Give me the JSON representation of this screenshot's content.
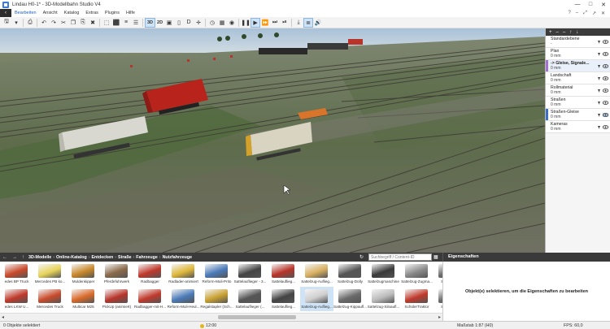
{
  "window": {
    "title": "Lindau H0-1* - 3D-Modellbahn Studio V4",
    "controls": [
      "—",
      "□",
      "✕"
    ]
  },
  "menu": {
    "back": "‹",
    "items": [
      "Bearbeiten",
      "Ansicht",
      "Katalog",
      "Extras",
      "Plugins",
      "Hilfe"
    ],
    "right": [
      "?",
      "–",
      "⤢",
      "↗",
      "✕"
    ]
  },
  "toolbar": {
    "view_3d": "3D",
    "view_2d": "2D"
  },
  "layers": {
    "toolbar": [
      "+",
      "–",
      "–",
      "↑",
      "↓"
    ],
    "items": [
      {
        "name": "Standardebene",
        "value": "-",
        "color": "#ffffff"
      },
      {
        "name": "Plan",
        "value": "0 mm",
        "color": "#ffffff"
      },
      {
        "name": "-> Gleise, Signale...",
        "value": "0 mm",
        "color": "#a36fd1"
      },
      {
        "name": "Landschaft",
        "value": "0 mm",
        "color": "#ffffff"
      },
      {
        "name": "Rollmaterial",
        "value": "0 mm",
        "color": "#ffffff"
      },
      {
        "name": "Straßen",
        "value": "0 mm",
        "color": "#ffffff"
      },
      {
        "name": "Straßen-Gleise",
        "value": "0 mm",
        "color": "#3b6fc4"
      },
      {
        "name": "Kameras",
        "value": "0 mm",
        "color": "#ffffff"
      }
    ]
  },
  "catalog": {
    "breadcrumb": [
      "3D-Modelle",
      "Online-Katalog",
      "Entdecken",
      "Straße",
      "Fahrzeuge",
      "Nutzfahrzeuge"
    ],
    "search_placeholder": "Suchbegriff / Content-ID",
    "row1": [
      {
        "label": "edes BP Truck",
        "color": "#c94a2a"
      },
      {
        "label": "Mercedes PB ko...",
        "color": "#e8d45a"
      },
      {
        "label": "Muldenkipper",
        "color": "#c9882a"
      },
      {
        "label": "Pferdefuhrwerk",
        "color": "#8a6a4a"
      },
      {
        "label": "Radbagger",
        "color": "#c0392b"
      },
      {
        "label": "Radlader-animiert",
        "color": "#e0b83a"
      },
      {
        "label": "Reform-Muli-Prito",
        "color": "#4a7ab8"
      },
      {
        "label": "Sattelauflieger - 3...",
        "color": "#444444"
      },
      {
        "label": "Sattelauflieg...",
        "color": "#b8342a"
      },
      {
        "label": "Sattelzug-Auflieg...",
        "color": "#d9b060"
      },
      {
        "label": "Sattelzug-Dolly",
        "color": "#555555"
      },
      {
        "label": "Sattelzugmaschine",
        "color": "#3a3a3a"
      },
      {
        "label": "Sattelzug-Zugma...",
        "color": "#8a8a8a"
      },
      {
        "label": "Schwerla...",
        "color": "#6a6a6a"
      }
    ],
    "row2": [
      {
        "label": "edes LKW U...",
        "color": "#c0392b"
      },
      {
        "label": "Mercedes Truck",
        "color": "#c94a2a"
      },
      {
        "label": "Multicar M25",
        "color": "#d96a2a"
      },
      {
        "label": "PickUp (animiert)",
        "color": "#b8342a"
      },
      {
        "label": "Radbagger-mit-H...",
        "color": "#c0392b"
      },
      {
        "label": "Reform-Muli-Heul...",
        "color": "#4a7ab8"
      },
      {
        "label": "Regalstapler (Sch...",
        "color": "#c9a030"
      },
      {
        "label": "Sattelauflieger (...",
        "color": "#555555"
      },
      {
        "label": "Sattelauflieg...",
        "color": "#444444"
      },
      {
        "label": "Sattelzug-Auflieg...",
        "color": "#cfcfcf"
      },
      {
        "label": "Sattelzug-Kippaufl...",
        "color": "#6a6a6a"
      },
      {
        "label": "Sattelzug-Siloaufl...",
        "color": "#bbbbbb"
      },
      {
        "label": "SchülerTraktor",
        "color": "#c0392b"
      },
      {
        "label": "Schwerla...",
        "color": "#6a6a6a"
      }
    ]
  },
  "properties": {
    "title": "Eigenschaften",
    "message": "Objekt(e) selektieren, um die Eigenschaften zu bearbeiten"
  },
  "status": {
    "selection": "0 Objekte selektiert",
    "time": "12:00",
    "scale": "Maßstab 1:87 (H0)",
    "fps": "FPS: 60,0"
  }
}
